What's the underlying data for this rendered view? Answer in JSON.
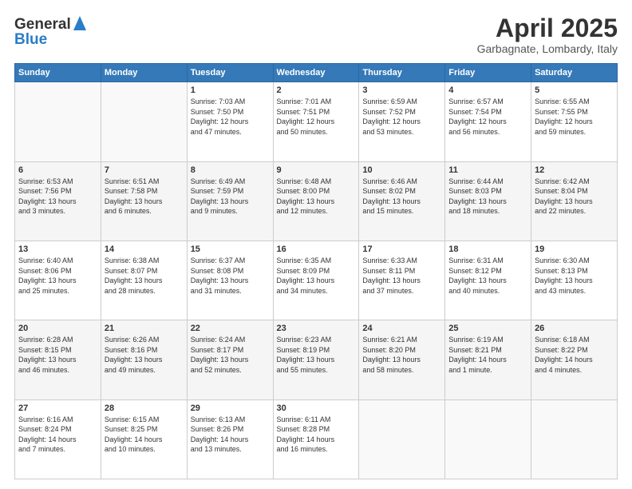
{
  "header": {
    "logo_line1": "General",
    "logo_line2": "Blue",
    "title": "April 2025",
    "subtitle": "Garbagnate, Lombardy, Italy"
  },
  "calendar": {
    "days_of_week": [
      "Sunday",
      "Monday",
      "Tuesday",
      "Wednesday",
      "Thursday",
      "Friday",
      "Saturday"
    ],
    "weeks": [
      [
        {
          "day": "",
          "empty": true
        },
        {
          "day": "",
          "empty": true
        },
        {
          "day": "1",
          "info": "Sunrise: 7:03 AM\nSunset: 7:50 PM\nDaylight: 12 hours\nand 47 minutes."
        },
        {
          "day": "2",
          "info": "Sunrise: 7:01 AM\nSunset: 7:51 PM\nDaylight: 12 hours\nand 50 minutes."
        },
        {
          "day": "3",
          "info": "Sunrise: 6:59 AM\nSunset: 7:52 PM\nDaylight: 12 hours\nand 53 minutes."
        },
        {
          "day": "4",
          "info": "Sunrise: 6:57 AM\nSunset: 7:54 PM\nDaylight: 12 hours\nand 56 minutes."
        },
        {
          "day": "5",
          "info": "Sunrise: 6:55 AM\nSunset: 7:55 PM\nDaylight: 12 hours\nand 59 minutes."
        }
      ],
      [
        {
          "day": "6",
          "info": "Sunrise: 6:53 AM\nSunset: 7:56 PM\nDaylight: 13 hours\nand 3 minutes."
        },
        {
          "day": "7",
          "info": "Sunrise: 6:51 AM\nSunset: 7:58 PM\nDaylight: 13 hours\nand 6 minutes."
        },
        {
          "day": "8",
          "info": "Sunrise: 6:49 AM\nSunset: 7:59 PM\nDaylight: 13 hours\nand 9 minutes."
        },
        {
          "day": "9",
          "info": "Sunrise: 6:48 AM\nSunset: 8:00 PM\nDaylight: 13 hours\nand 12 minutes."
        },
        {
          "day": "10",
          "info": "Sunrise: 6:46 AM\nSunset: 8:02 PM\nDaylight: 13 hours\nand 15 minutes."
        },
        {
          "day": "11",
          "info": "Sunrise: 6:44 AM\nSunset: 8:03 PM\nDaylight: 13 hours\nand 18 minutes."
        },
        {
          "day": "12",
          "info": "Sunrise: 6:42 AM\nSunset: 8:04 PM\nDaylight: 13 hours\nand 22 minutes."
        }
      ],
      [
        {
          "day": "13",
          "info": "Sunrise: 6:40 AM\nSunset: 8:06 PM\nDaylight: 13 hours\nand 25 minutes."
        },
        {
          "day": "14",
          "info": "Sunrise: 6:38 AM\nSunset: 8:07 PM\nDaylight: 13 hours\nand 28 minutes."
        },
        {
          "day": "15",
          "info": "Sunrise: 6:37 AM\nSunset: 8:08 PM\nDaylight: 13 hours\nand 31 minutes."
        },
        {
          "day": "16",
          "info": "Sunrise: 6:35 AM\nSunset: 8:09 PM\nDaylight: 13 hours\nand 34 minutes."
        },
        {
          "day": "17",
          "info": "Sunrise: 6:33 AM\nSunset: 8:11 PM\nDaylight: 13 hours\nand 37 minutes."
        },
        {
          "day": "18",
          "info": "Sunrise: 6:31 AM\nSunset: 8:12 PM\nDaylight: 13 hours\nand 40 minutes."
        },
        {
          "day": "19",
          "info": "Sunrise: 6:30 AM\nSunset: 8:13 PM\nDaylight: 13 hours\nand 43 minutes."
        }
      ],
      [
        {
          "day": "20",
          "info": "Sunrise: 6:28 AM\nSunset: 8:15 PM\nDaylight: 13 hours\nand 46 minutes."
        },
        {
          "day": "21",
          "info": "Sunrise: 6:26 AM\nSunset: 8:16 PM\nDaylight: 13 hours\nand 49 minutes."
        },
        {
          "day": "22",
          "info": "Sunrise: 6:24 AM\nSunset: 8:17 PM\nDaylight: 13 hours\nand 52 minutes."
        },
        {
          "day": "23",
          "info": "Sunrise: 6:23 AM\nSunset: 8:19 PM\nDaylight: 13 hours\nand 55 minutes."
        },
        {
          "day": "24",
          "info": "Sunrise: 6:21 AM\nSunset: 8:20 PM\nDaylight: 13 hours\nand 58 minutes."
        },
        {
          "day": "25",
          "info": "Sunrise: 6:19 AM\nSunset: 8:21 PM\nDaylight: 14 hours\nand 1 minute."
        },
        {
          "day": "26",
          "info": "Sunrise: 6:18 AM\nSunset: 8:22 PM\nDaylight: 14 hours\nand 4 minutes."
        }
      ],
      [
        {
          "day": "27",
          "info": "Sunrise: 6:16 AM\nSunset: 8:24 PM\nDaylight: 14 hours\nand 7 minutes."
        },
        {
          "day": "28",
          "info": "Sunrise: 6:15 AM\nSunset: 8:25 PM\nDaylight: 14 hours\nand 10 minutes."
        },
        {
          "day": "29",
          "info": "Sunrise: 6:13 AM\nSunset: 8:26 PM\nDaylight: 14 hours\nand 13 minutes."
        },
        {
          "day": "30",
          "info": "Sunrise: 6:11 AM\nSunset: 8:28 PM\nDaylight: 14 hours\nand 16 minutes."
        },
        {
          "day": "",
          "empty": true
        },
        {
          "day": "",
          "empty": true
        },
        {
          "day": "",
          "empty": true
        }
      ]
    ]
  }
}
